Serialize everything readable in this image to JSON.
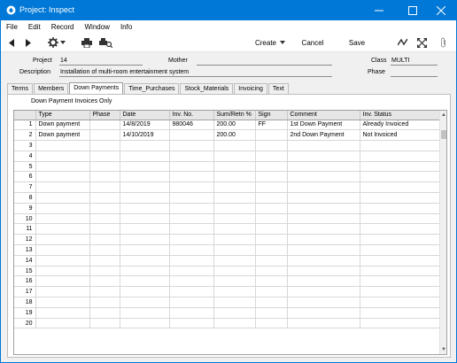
{
  "window": {
    "title": "Project: Inspect",
    "minimize_glyph": "—",
    "maximize_glyph": "☐",
    "close_glyph": "✕"
  },
  "menu": [
    "File",
    "Edit",
    "Record",
    "Window",
    "Info"
  ],
  "toolbar": {
    "create_label": "Create",
    "cancel_label": "Cancel",
    "save_label": "Save"
  },
  "header": {
    "project_label": "Project",
    "project_value": "14",
    "mother_label": "Mother",
    "mother_value": "",
    "class_label": "Class",
    "class_value": "MULTI",
    "description_label": "Description",
    "description_value": "Installation of multi-room entertainment system",
    "phase_label": "Phase",
    "phase_value": ""
  },
  "tabs": [
    {
      "label": "Terms",
      "active": false
    },
    {
      "label": "Members",
      "active": false
    },
    {
      "label": "Down Payments",
      "active": true
    },
    {
      "label": "Time_Purchases",
      "active": false
    },
    {
      "label": "Stock_Materials",
      "active": false
    },
    {
      "label": "Invoicing",
      "active": false
    },
    {
      "label": "Text",
      "active": false
    }
  ],
  "panel": {
    "filter_label": "Down Payment Invoices Only"
  },
  "grid": {
    "columns": [
      "",
      "Type",
      "Phase",
      "Date",
      "Inv. No.",
      "Sum/Retn %",
      "Sign",
      "Comment",
      "Inv. Status"
    ],
    "rows": [
      [
        "1",
        "Down payment",
        "",
        "14/8/2019",
        "980046",
        "200.00",
        "FF",
        "1st Down Payment",
        "Already Invoiced"
      ],
      [
        "2",
        "Down payment",
        "",
        "14/10/2019",
        "",
        "200.00",
        "",
        "2nd Down Payment",
        "Not Invoiced"
      ],
      [
        "3",
        "",
        "",
        "",
        "",
        "",
        "",
        "",
        ""
      ],
      [
        "4",
        "",
        "",
        "",
        "",
        "",
        "",
        "",
        ""
      ],
      [
        "5",
        "",
        "",
        "",
        "",
        "",
        "",
        "",
        ""
      ],
      [
        "6",
        "",
        "",
        "",
        "",
        "",
        "",
        "",
        ""
      ],
      [
        "7",
        "",
        "",
        "",
        "",
        "",
        "",
        "",
        ""
      ],
      [
        "8",
        "",
        "",
        "",
        "",
        "",
        "",
        "",
        ""
      ],
      [
        "9",
        "",
        "",
        "",
        "",
        "",
        "",
        "",
        ""
      ],
      [
        "10",
        "",
        "",
        "",
        "",
        "",
        "",
        "",
        ""
      ],
      [
        "11",
        "",
        "",
        "",
        "",
        "",
        "",
        "",
        ""
      ],
      [
        "12",
        "",
        "",
        "",
        "",
        "",
        "",
        "",
        ""
      ],
      [
        "13",
        "",
        "",
        "",
        "",
        "",
        "",
        "",
        ""
      ],
      [
        "14",
        "",
        "",
        "",
        "",
        "",
        "",
        "",
        ""
      ],
      [
        "15",
        "",
        "",
        "",
        "",
        "",
        "",
        "",
        ""
      ],
      [
        "16",
        "",
        "",
        "",
        "",
        "",
        "",
        "",
        ""
      ],
      [
        "17",
        "",
        "",
        "",
        "",
        "",
        "",
        "",
        ""
      ],
      [
        "18",
        "",
        "",
        "",
        "",
        "",
        "",
        "",
        ""
      ],
      [
        "19",
        "",
        "",
        "",
        "",
        "",
        "",
        "",
        ""
      ],
      [
        "20",
        "",
        "",
        "",
        "",
        "",
        "",
        "",
        ""
      ]
    ]
  },
  "icons": {
    "app": "app-icon",
    "prev": "prev-record-icon",
    "next": "next-record-icon",
    "operations": "gear-icon",
    "print": "printer-icon",
    "print_preview": "print-preview-icon",
    "create_dropdown": "chevron-down-icon",
    "signal": "activity-icon",
    "expand": "expand-icon",
    "attach": "paperclip-icon"
  },
  "colors": {
    "titlebar": "#0078d7",
    "active_tab": "#ffffff",
    "grid_header": "#e6e6e6"
  }
}
